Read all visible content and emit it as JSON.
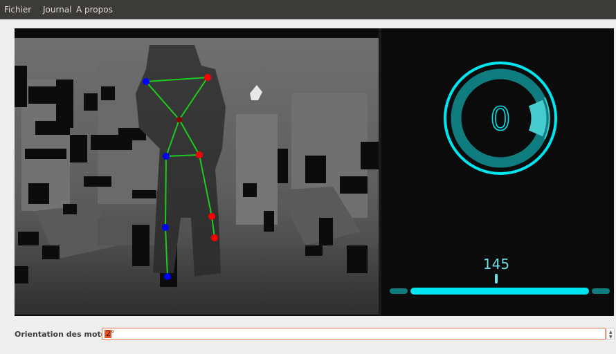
{
  "menu": {
    "file": "Fichier",
    "journal": "Journal",
    "about": "A propos"
  },
  "hud": {
    "gauge_value": "0",
    "slider_value": "145",
    "accent": "#00e6f0",
    "ring_dark": "#0f7d80",
    "ring_light": "#46cbcf"
  },
  "skeleton": {
    "bone_color": "#1ccc1c",
    "joint_left_color": "#0000ff",
    "joint_right_color": "#ff0000",
    "joint_center_color": "#8b0000"
  },
  "controls": {
    "orientation_label": "Orientation des moteurs:",
    "orientation_value": "2°"
  }
}
